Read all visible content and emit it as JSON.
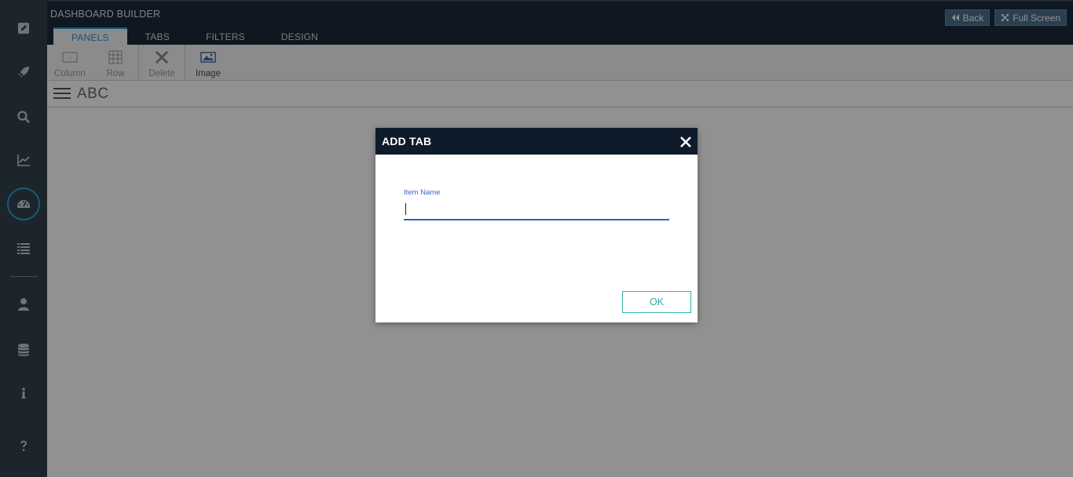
{
  "app": {
    "title": "DASHBOARD BUILDER"
  },
  "header": {
    "tabs": [
      {
        "label": "PANELS",
        "active": true
      },
      {
        "label": "TABS",
        "active": false
      },
      {
        "label": "FILTERS",
        "active": false
      },
      {
        "label": "DESIGN",
        "active": false
      }
    ],
    "back_label": "Back",
    "fullscreen_label": "Full Screen"
  },
  "toolbar": {
    "column_label": "Column",
    "row_label": "Row",
    "delete_label": "Delete",
    "image_label": "Image"
  },
  "rail": {
    "items": [
      "edit-icon",
      "rocket-icon",
      "search-icon",
      "chart-icon",
      "dashboard-icon",
      "list-icon",
      "user-icon",
      "database-icon",
      "info-icon",
      "help-icon"
    ],
    "active": "dashboard-icon"
  },
  "subheader": {
    "dashboard_name": "ABC"
  },
  "dialog": {
    "title": "ADD TAB",
    "field_label": "Item Name",
    "field_value": "",
    "ok_label": "OK"
  },
  "colors": {
    "rail": "#34414e",
    "header": "#1b2a3a",
    "accent": "#2a9fd6",
    "dialog_header": "#0e1b2a",
    "ok_button": "#36b3a8",
    "input_underline": "#3b5bc4"
  }
}
